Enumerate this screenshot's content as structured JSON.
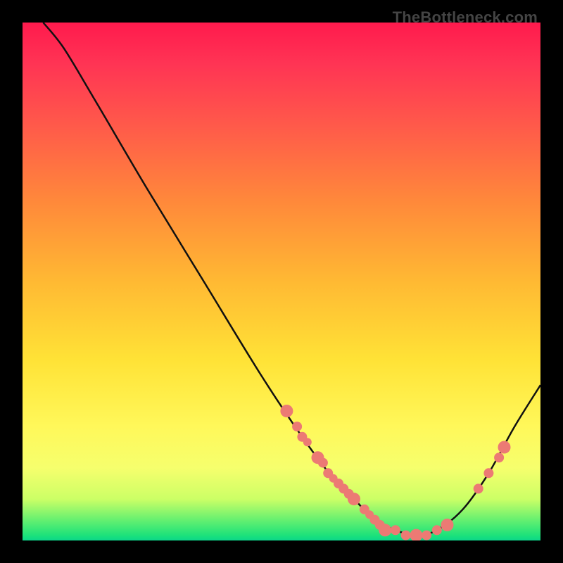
{
  "watermark": "TheBottleneck.com",
  "chart_data": {
    "type": "line",
    "title": "",
    "xlabel": "",
    "ylabel": "",
    "xlim": [
      0,
      100
    ],
    "ylim": [
      0,
      100
    ],
    "grid": false,
    "legend": null,
    "line": {
      "points": [
        {
          "x": 4,
          "y": 100
        },
        {
          "x": 8,
          "y": 95
        },
        {
          "x": 14,
          "y": 85
        },
        {
          "x": 24,
          "y": 68
        },
        {
          "x": 35,
          "y": 50
        },
        {
          "x": 46,
          "y": 32
        },
        {
          "x": 54,
          "y": 20
        },
        {
          "x": 60,
          "y": 12
        },
        {
          "x": 64,
          "y": 8
        },
        {
          "x": 68,
          "y": 4
        },
        {
          "x": 72,
          "y": 2
        },
        {
          "x": 76,
          "y": 1
        },
        {
          "x": 80,
          "y": 2
        },
        {
          "x": 85,
          "y": 6
        },
        {
          "x": 90,
          "y": 13
        },
        {
          "x": 95,
          "y": 22
        },
        {
          "x": 100,
          "y": 30
        }
      ]
    },
    "dots": [
      {
        "x": 51,
        "y": 25,
        "size": "lg"
      },
      {
        "x": 53,
        "y": 22,
        "size": "md"
      },
      {
        "x": 54,
        "y": 20,
        "size": "md"
      },
      {
        "x": 55,
        "y": 19,
        "size": "sm"
      },
      {
        "x": 57,
        "y": 16,
        "size": "lg"
      },
      {
        "x": 58,
        "y": 15,
        "size": "md"
      },
      {
        "x": 59,
        "y": 13,
        "size": "md"
      },
      {
        "x": 60,
        "y": 12,
        "size": "sm"
      },
      {
        "x": 61,
        "y": 11,
        "size": "md"
      },
      {
        "x": 62,
        "y": 10,
        "size": "md"
      },
      {
        "x": 63,
        "y": 9,
        "size": "md"
      },
      {
        "x": 64,
        "y": 8,
        "size": "lg"
      },
      {
        "x": 66,
        "y": 6,
        "size": "md"
      },
      {
        "x": 67,
        "y": 5,
        "size": "sm"
      },
      {
        "x": 68,
        "y": 4,
        "size": "md"
      },
      {
        "x": 69,
        "y": 3,
        "size": "md"
      },
      {
        "x": 70,
        "y": 2,
        "size": "lg"
      },
      {
        "x": 72,
        "y": 2,
        "size": "md"
      },
      {
        "x": 74,
        "y": 1,
        "size": "md"
      },
      {
        "x": 76,
        "y": 1,
        "size": "lg"
      },
      {
        "x": 78,
        "y": 1,
        "size": "md"
      },
      {
        "x": 80,
        "y": 2,
        "size": "md"
      },
      {
        "x": 82,
        "y": 3,
        "size": "lg"
      },
      {
        "x": 88,
        "y": 10,
        "size": "md"
      },
      {
        "x": 90,
        "y": 13,
        "size": "md"
      },
      {
        "x": 92,
        "y": 16,
        "size": "md"
      },
      {
        "x": 93,
        "y": 18,
        "size": "lg"
      }
    ]
  }
}
